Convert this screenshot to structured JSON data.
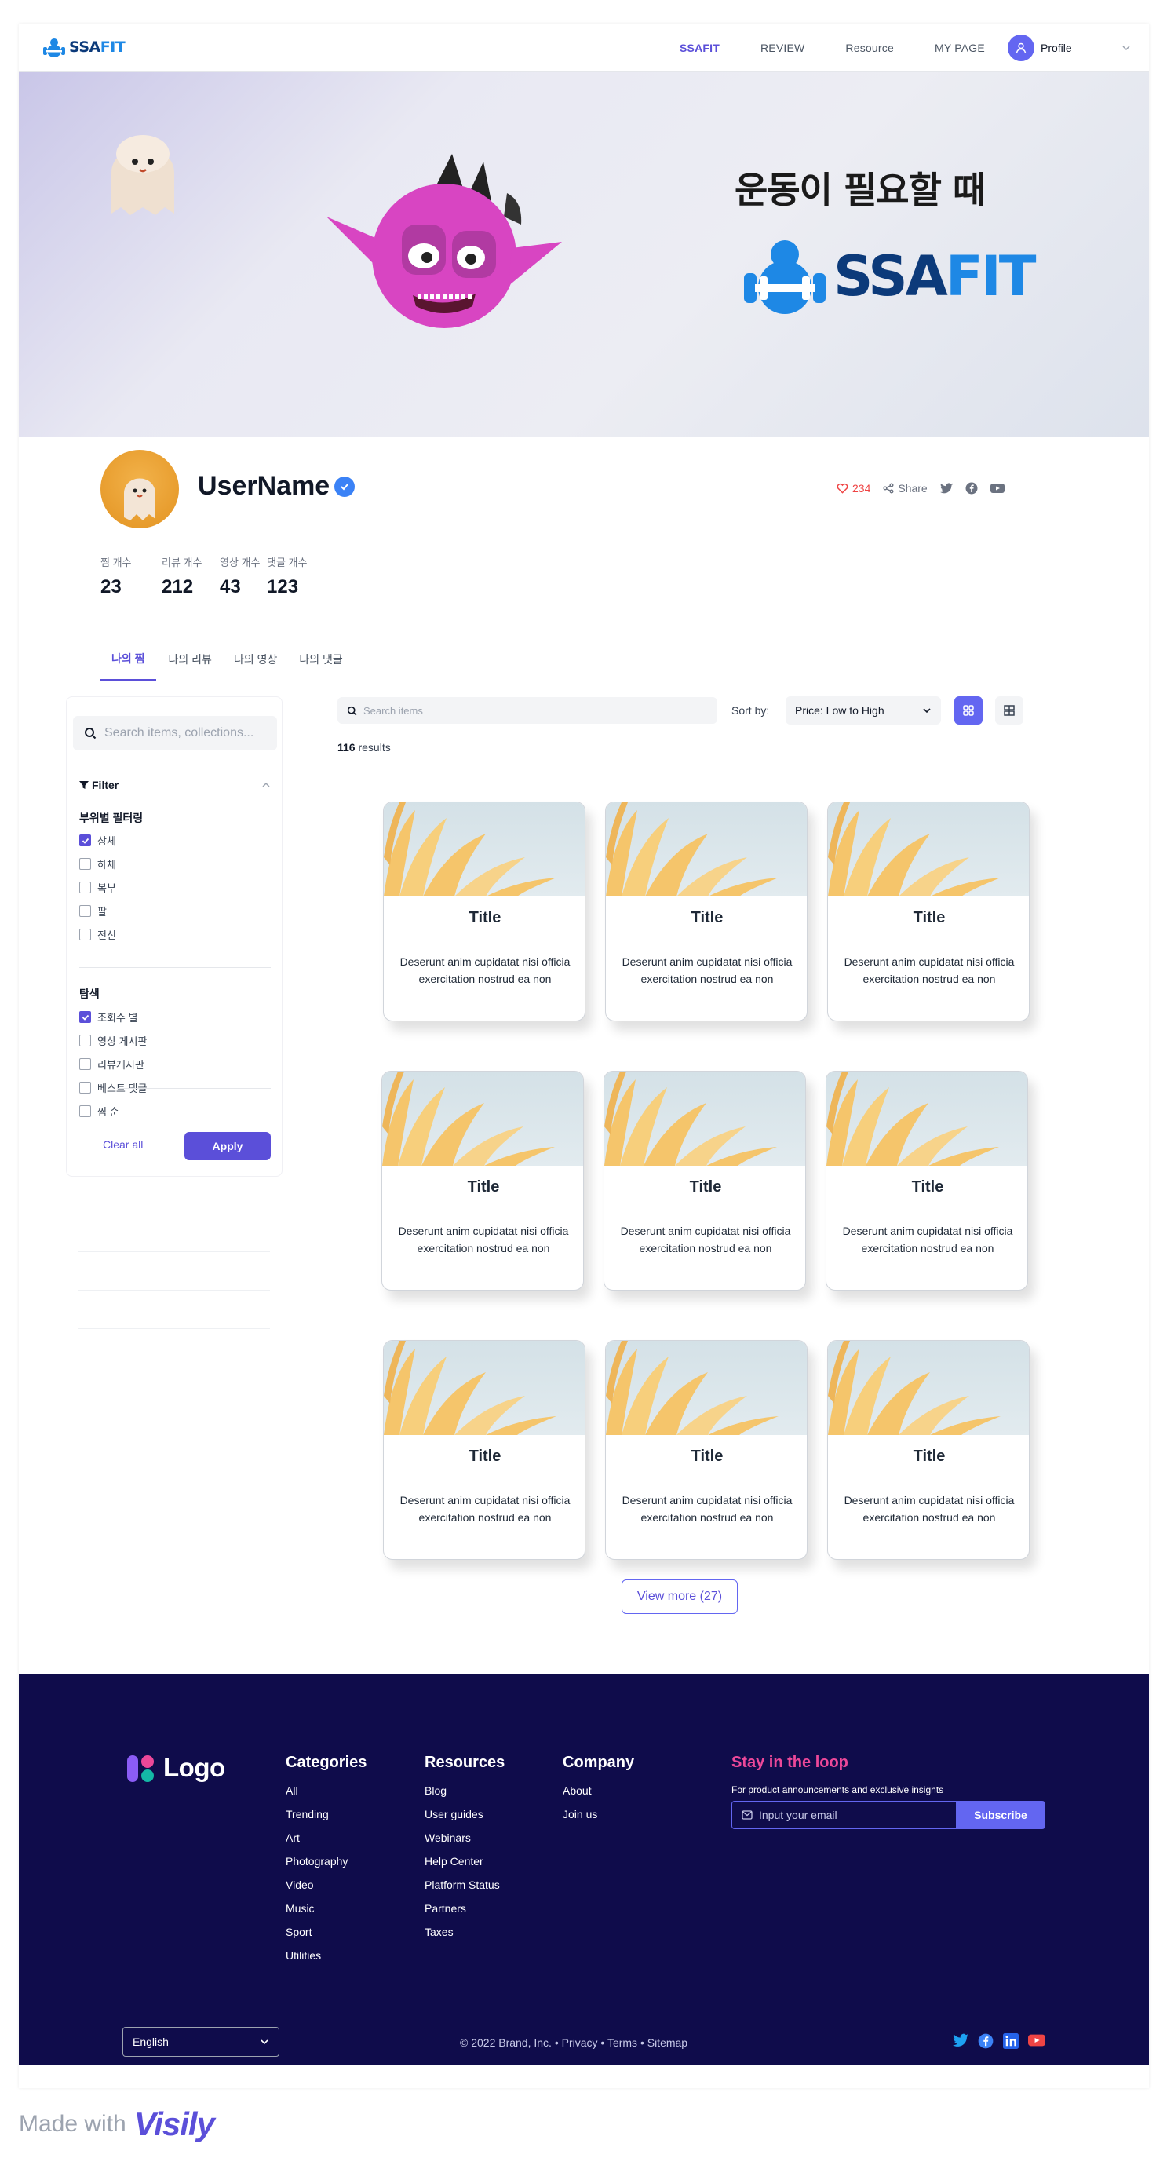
{
  "header": {
    "brand": {
      "part1": "SSA",
      "part2": "FIT"
    },
    "nav": [
      {
        "label": "SSAFIT",
        "active": true
      },
      {
        "label": "REVIEW",
        "active": false
      },
      {
        "label": "Resource",
        "active": false
      },
      {
        "label": "MY PAGE",
        "active": false
      }
    ],
    "profile_label": "Profile"
  },
  "banner": {
    "title": "운동이 필요할 때",
    "logo": {
      "part1": "SSA",
      "part2": "FIT"
    }
  },
  "profile": {
    "username": "UserName",
    "likes": "234",
    "share_label": "Share",
    "stats": [
      {
        "label": "찜 개수",
        "value": "23"
      },
      {
        "label": "리뷰 개수",
        "value": "212"
      },
      {
        "label": "영상 개수",
        "value": "43"
      },
      {
        "label": "댓글 개수",
        "value": "123"
      }
    ]
  },
  "tabs": [
    {
      "label": "나의 찜",
      "active": true
    },
    {
      "label": "나의 리뷰",
      "active": false
    },
    {
      "label": "나의 영상",
      "active": false
    },
    {
      "label": "나의 댓글",
      "active": false
    }
  ],
  "sidebar": {
    "search_placeholder": "Search items, collections...",
    "filter_label": "Filter",
    "groups": [
      {
        "title": "부위별 필터링",
        "options": [
          {
            "label": "상체",
            "checked": true
          },
          {
            "label": "하체",
            "checked": false
          },
          {
            "label": "복부",
            "checked": false
          },
          {
            "label": "팔",
            "checked": false
          },
          {
            "label": "전신",
            "checked": false
          }
        ]
      },
      {
        "title": "탐색",
        "options": [
          {
            "label": "조회수 별",
            "checked": true
          },
          {
            "label": "영상 게시판",
            "checked": false
          },
          {
            "label": "리뷰게시판",
            "checked": false
          },
          {
            "label": "베스트 댓글",
            "checked": false
          },
          {
            "label": "찜 순",
            "checked": false
          }
        ]
      }
    ],
    "clear_label": "Clear all",
    "apply_label": "Apply"
  },
  "main": {
    "search_placeholder": "Search items",
    "sort_label": "Sort by:",
    "sort_value": "Price: Low to High",
    "results_count": "116",
    "results_label": "results",
    "cards": [
      {
        "title": "Title",
        "desc": "Deserunt anim cupidatat nisi officia exercitation nostrud ea non"
      },
      {
        "title": "Title",
        "desc": "Deserunt anim cupidatat nisi officia exercitation nostrud ea non"
      },
      {
        "title": "Title",
        "desc": "Deserunt anim cupidatat nisi officia exercitation nostrud ea non"
      },
      {
        "title": "Title",
        "desc": "Deserunt anim cupidatat nisi officia exercitation nostrud ea non"
      },
      {
        "title": "Title",
        "desc": "Deserunt anim cupidatat nisi officia exercitation nostrud ea non"
      },
      {
        "title": "Title",
        "desc": "Deserunt anim cupidatat nisi officia exercitation nostrud ea non"
      },
      {
        "title": "Title",
        "desc": "Deserunt anim cupidatat nisi officia exercitation nostrud ea non"
      },
      {
        "title": "Title",
        "desc": "Deserunt anim cupidatat nisi officia exercitation nostrud ea non"
      },
      {
        "title": "Title",
        "desc": "Deserunt anim cupidatat nisi officia exercitation nostrud ea non"
      }
    ],
    "view_more": "View more (27)"
  },
  "footer": {
    "logo_text": "Logo",
    "columns": [
      {
        "title": "Categories",
        "links": [
          "All",
          "Trending",
          "Art",
          "Photography",
          "Video",
          "Music",
          "Sport",
          "Utilities"
        ]
      },
      {
        "title": "Resources",
        "links": [
          "Blog",
          "User guides",
          "Webinars",
          "Help Center",
          "Platform Status",
          "Partners",
          "Taxes"
        ]
      },
      {
        "title": "Company",
        "links": [
          "About",
          "Join us"
        ]
      }
    ],
    "loop_title": "Stay in the loop",
    "loop_desc": "For product announcements and exclusive insights",
    "email_placeholder": "Input your email",
    "subscribe_label": "Subscribe",
    "language": "English",
    "copyright": "© 2022 Brand, Inc. • Privacy • Terms • Sitemap"
  },
  "made_with": {
    "text": "Made with",
    "brand": "Visily"
  },
  "colors": {
    "accent": "#5b4fd9",
    "footer_bg": "#0f0c4b",
    "brand_dark": "#0c3a7a",
    "brand_light": "#1e88e5",
    "pink": "#ec4899"
  }
}
